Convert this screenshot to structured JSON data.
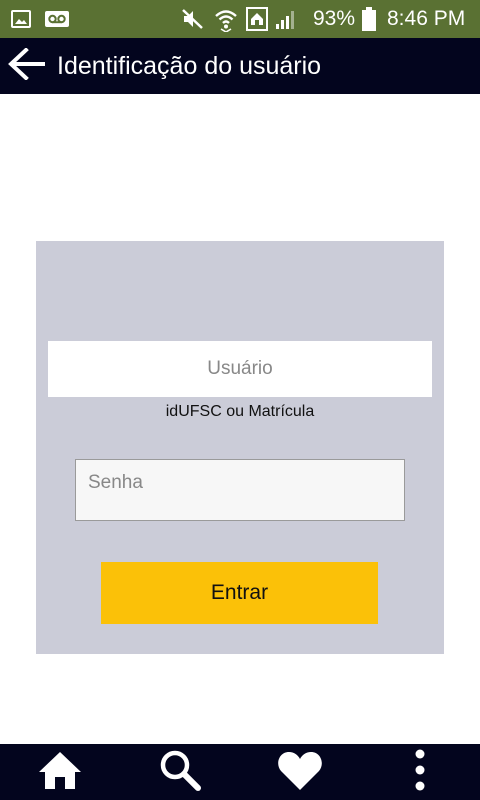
{
  "status_bar": {
    "battery": "93%",
    "time": "8:46 PM",
    "icons": [
      "image-icon",
      "voicemail-icon",
      "mute-icon",
      "wifi-icon",
      "home-data-icon",
      "signal-icon",
      "battery-icon"
    ]
  },
  "app_bar": {
    "title": "Identificação do usuário",
    "back_icon": "arrow-left-icon"
  },
  "login": {
    "username_placeholder": "Usuário",
    "username_value": "",
    "username_hint": "idUFSC ou Matrícula",
    "password_placeholder": "Senha",
    "password_value": "",
    "submit_label": "Entrar"
  },
  "bottom_nav": {
    "items": [
      "home-icon",
      "search-icon",
      "heart-icon",
      "more-vert-icon"
    ]
  },
  "colors": {
    "status_bar": "#5a7133",
    "app_bar": "#03051e",
    "panel": "#cbccd8",
    "button": "#fbc108"
  }
}
